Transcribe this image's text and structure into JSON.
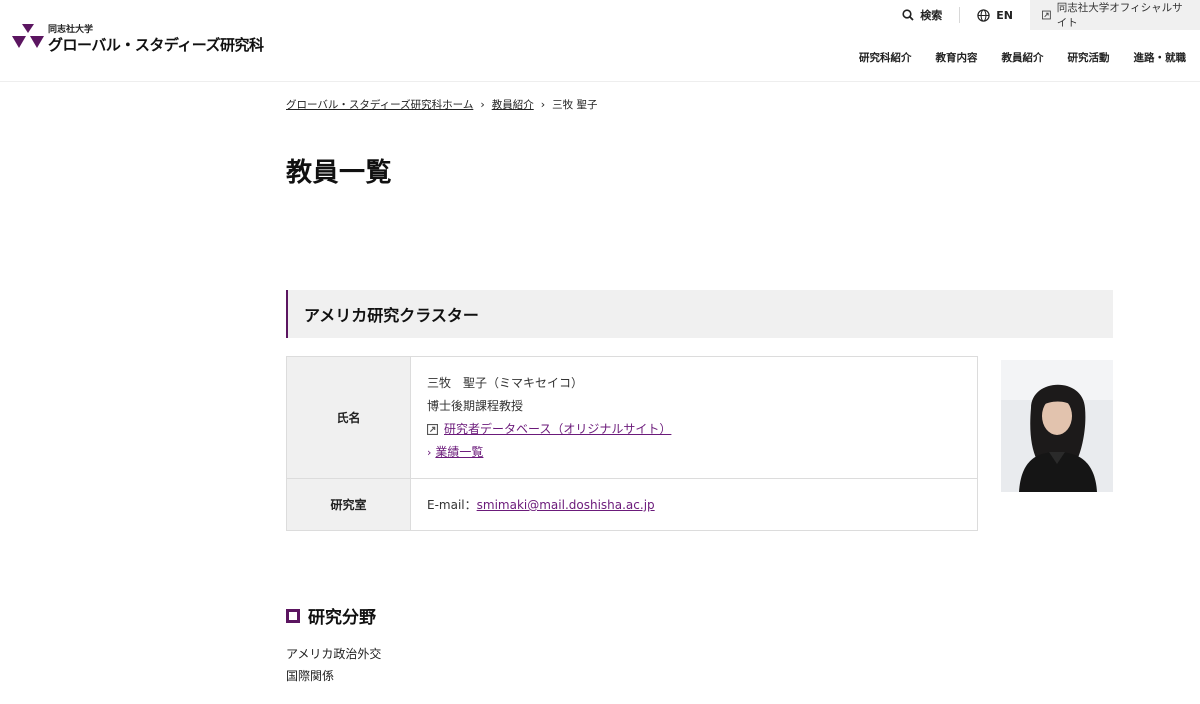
{
  "logo": {
    "university": "同志社大学",
    "graduate_school": "グローバル・スタディーズ研究科"
  },
  "utility": {
    "search_label": "検索",
    "language_label": "EN",
    "official_site_label": "同志社大学オフィシャルサイト"
  },
  "global_nav": {
    "items": [
      {
        "label": "研究科紹介"
      },
      {
        "label": "教育内容"
      },
      {
        "label": "教員紹介"
      },
      {
        "label": "研究活動"
      },
      {
        "label": "進路・就職"
      }
    ]
  },
  "breadcrumb": {
    "home": "グローバル・スタディーズ研究科ホーム",
    "parent": "教員紹介",
    "current": "三牧 聖子"
  },
  "page_title": "教員一覧",
  "cluster_title": "アメリカ研究クラスター",
  "profile": {
    "name_header": "氏名",
    "name": "三牧　聖子（ミマキセイコ）",
    "position": "博士後期課程教授",
    "database_link": "研究者データベース（オリジナルサイト）",
    "achievements_link": "業績一覧",
    "lab_header": "研究室",
    "email_label": "E-mail：",
    "email": "smimaki@mail.doshisha.ac.jp"
  },
  "research": {
    "title": "研究分野",
    "fields": [
      "アメリカ政治外交",
      "国際関係"
    ]
  },
  "colors": {
    "brand_purple": "#5b1560",
    "link_purple": "#6b1a7a",
    "panel_gray": "#f0f0f0"
  }
}
